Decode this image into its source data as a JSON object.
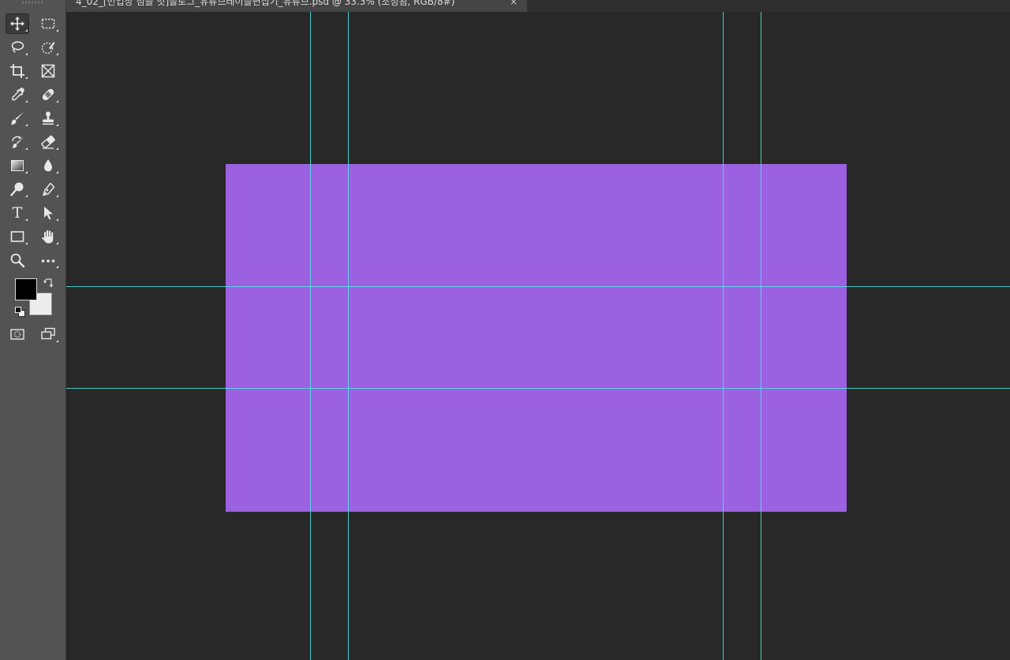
{
  "document": {
    "tab_title": "4_02_[번입장 점을 잇]블로그_유튜브레이블편집기_유튜브.psd @ 33.3% (조정됨, RGB/8#)",
    "close_glyph": "×"
  },
  "toolbar": {
    "tools": [
      {
        "name": "move-tool",
        "icon": "move-icon",
        "active": true
      },
      {
        "name": "marquee-tool",
        "icon": "marquee-icon"
      },
      {
        "name": "lasso-tool",
        "icon": "lasso-icon"
      },
      {
        "name": "quick-selection-tool",
        "icon": "quick-selection-icon"
      },
      {
        "name": "crop-tool",
        "icon": "crop-icon"
      },
      {
        "name": "frame-tool",
        "icon": "frame-icon"
      },
      {
        "name": "eyedropper-tool",
        "icon": "eyedropper-icon"
      },
      {
        "name": "healing-brush-tool",
        "icon": "bandage-icon"
      },
      {
        "name": "brush-tool",
        "icon": "brush-icon"
      },
      {
        "name": "clone-stamp-tool",
        "icon": "stamp-icon"
      },
      {
        "name": "history-brush-tool",
        "icon": "history-brush-icon"
      },
      {
        "name": "eraser-tool",
        "icon": "eraser-icon"
      },
      {
        "name": "gradient-tool",
        "icon": "gradient-icon"
      },
      {
        "name": "blur-tool",
        "icon": "drop-icon"
      },
      {
        "name": "dodge-tool",
        "icon": "dodge-icon"
      },
      {
        "name": "pen-tool",
        "icon": "pen-icon"
      },
      {
        "name": "type-tool",
        "icon": "type-icon",
        "glyph": "T"
      },
      {
        "name": "path-selection-tool",
        "icon": "arrow-icon"
      },
      {
        "name": "shape-tool",
        "icon": "rectangle-icon"
      },
      {
        "name": "hand-tool",
        "icon": "hand-icon"
      },
      {
        "name": "zoom-tool",
        "icon": "magnifier-icon"
      },
      {
        "name": "edit-toolbar",
        "icon": "more-icon"
      },
      {
        "name": "quick-mask-mode",
        "icon": "quick-mask-icon"
      },
      {
        "name": "screen-mode",
        "icon": "screen-mode-icon"
      }
    ],
    "foreground_color": "#000000",
    "background_color": "#ededed"
  },
  "canvas": {
    "background": "#282828",
    "artboard_fill": "#9b61e0",
    "guide_color": "#4fe6e6"
  }
}
